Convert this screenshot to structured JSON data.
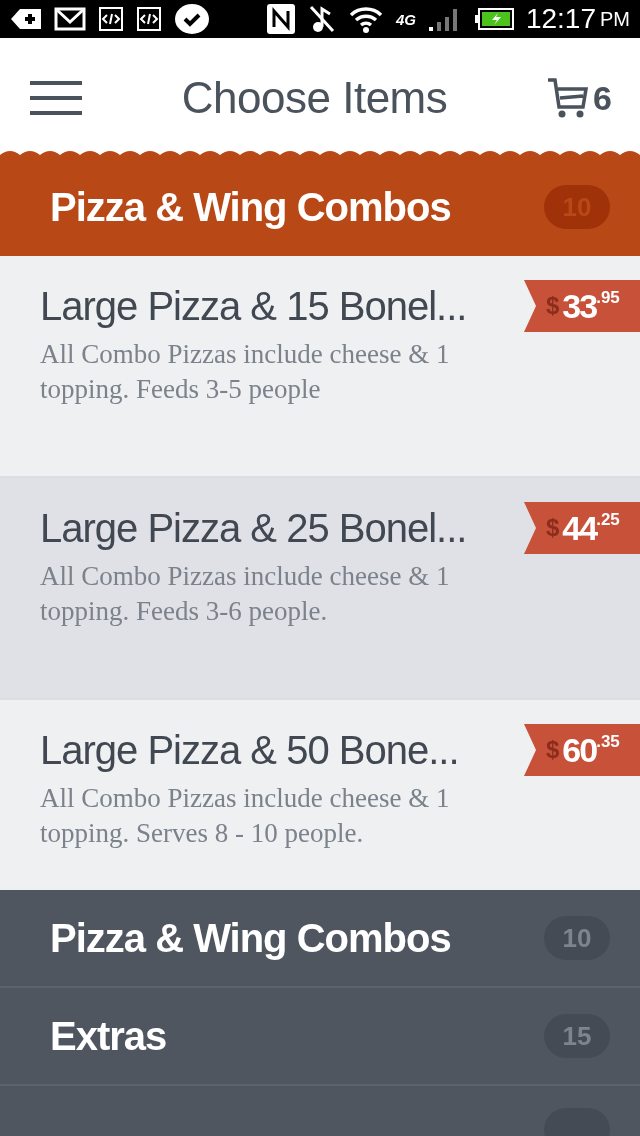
{
  "status_bar": {
    "time": "12:17",
    "meridiem": "PM",
    "network": "4G"
  },
  "header": {
    "title": "Choose Items",
    "cart_count": "6"
  },
  "current_category": {
    "title": "Pizza & Wing Combos",
    "count": "10"
  },
  "items": [
    {
      "title": "Large Pizza & 15 Bonel...",
      "description": "All Combo Pizzas include cheese & 1 topping. Feeds 3-5 people",
      "price": {
        "currency": "$",
        "whole": "33",
        "cents": ".95"
      },
      "selected": false
    },
    {
      "title": "Large Pizza & 25 Bonel...",
      "description": "All Combo Pizzas include cheese & 1 topping. Feeds 3-6 people.",
      "price": {
        "currency": "$",
        "whole": "44",
        "cents": ".25"
      },
      "selected": true
    },
    {
      "title": "Large Pizza & 50 Bone...",
      "description": "All Combo Pizzas include cheese & 1 topping. Serves 8 - 10 people.",
      "price": {
        "currency": "$",
        "whole": "60",
        "cents": ".35"
      },
      "selected": false
    }
  ],
  "categories": [
    {
      "title": "Pizza & Wing Combos",
      "count": "10"
    },
    {
      "title": "Extras",
      "count": "15"
    }
  ]
}
